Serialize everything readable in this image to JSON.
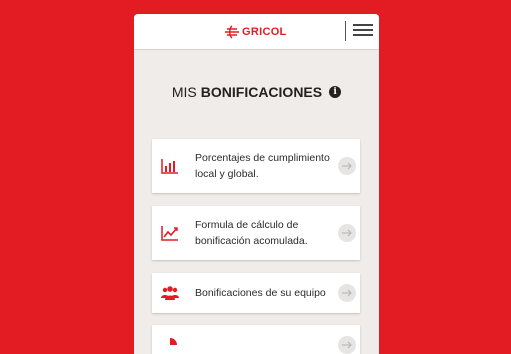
{
  "header": {
    "logo_text": "GRICOL",
    "menu_icon": "hamburger-menu-icon"
  },
  "page": {
    "title_light": "MIS",
    "title_bold": "BONIFICACIONES",
    "info_icon": "info-icon"
  },
  "cards": [
    {
      "label": "Porcentajes de cumplimiento local y global.",
      "icon": "bar-chart-icon"
    },
    {
      "label": "Formula de cálculo de bonificación acomulada.",
      "icon": "line-chart-icon"
    },
    {
      "label": "Bonificaciones de su equipo",
      "icon": "team-icon"
    }
  ],
  "colors": {
    "brand_red": "#e31b23",
    "background": "#efece9",
    "card": "#ffffff"
  }
}
